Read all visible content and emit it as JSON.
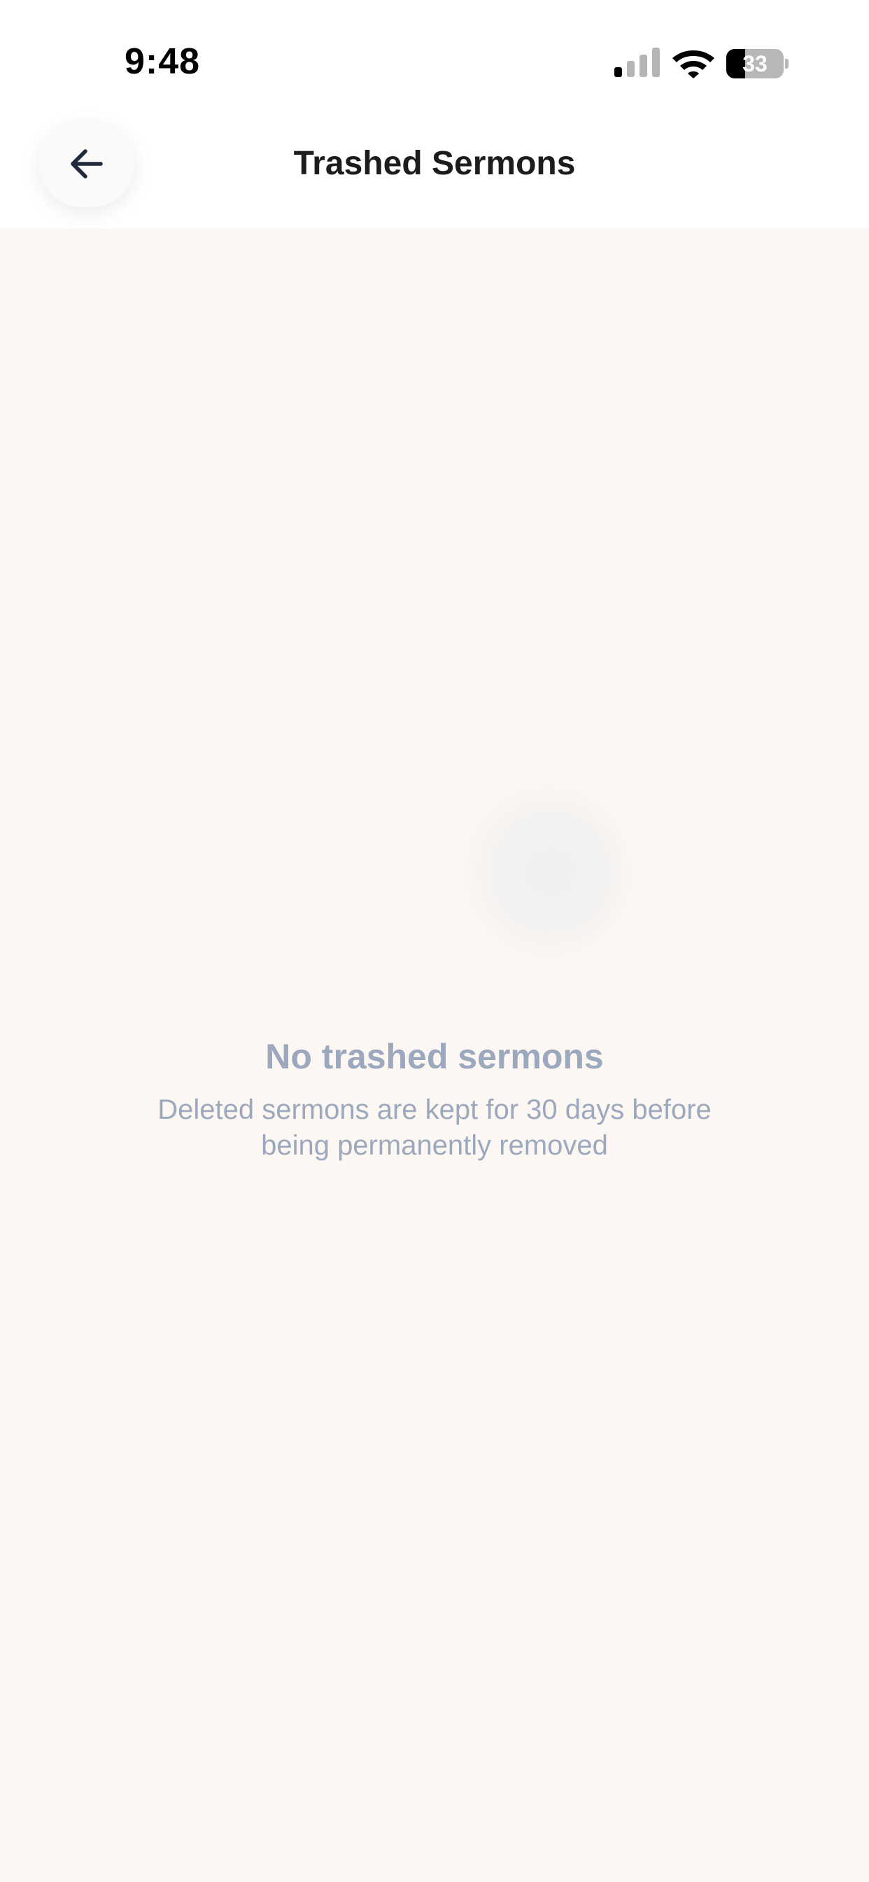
{
  "status_bar": {
    "time": "9:48",
    "battery_percent": "33",
    "battery_level": 0.33,
    "signal_icon": "cellular-signal-icon",
    "wifi_icon": "wifi-icon",
    "battery_icon": "battery-icon"
  },
  "header": {
    "title": "Trashed Sermons",
    "back_icon": "arrow-left-icon"
  },
  "empty_state": {
    "title": "No trashed sermons",
    "subtitle_line1": "Deleted sermons are kept for 30 days before",
    "subtitle_line2": "being permanently removed"
  },
  "colors": {
    "background": "#fcf7f2",
    "header_background": "#ffffff",
    "title_text": "#1c1c1e",
    "empty_text": "#9ba8bd"
  }
}
